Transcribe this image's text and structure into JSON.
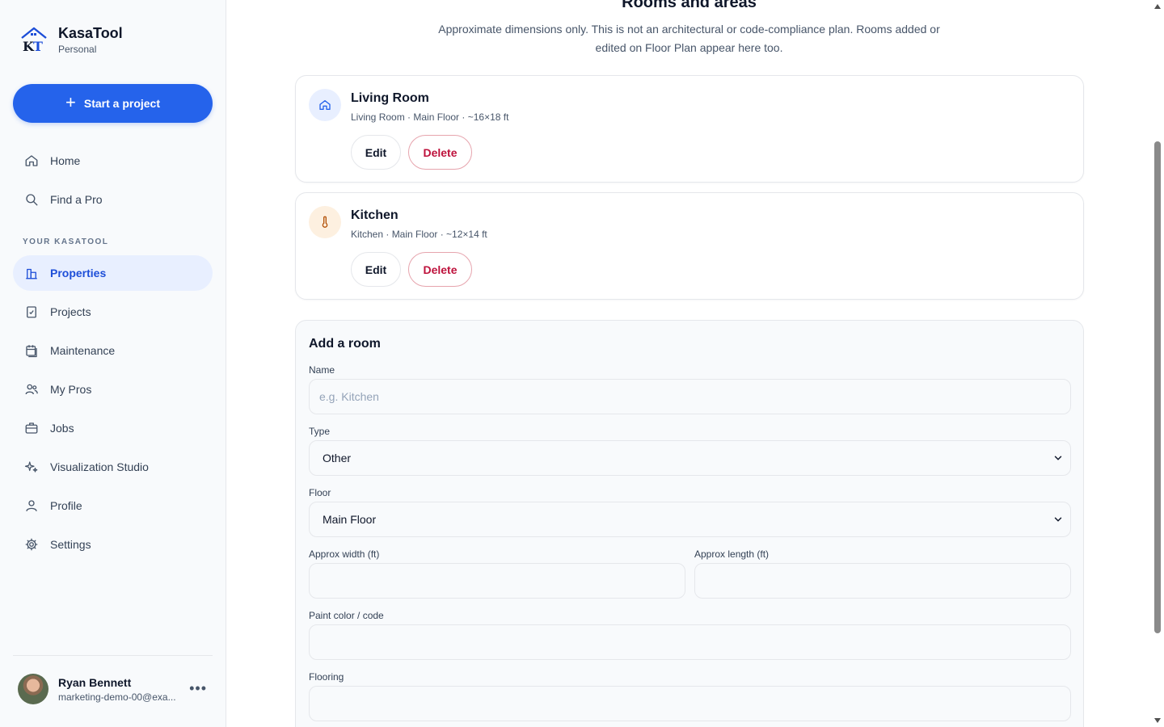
{
  "brand": {
    "name": "KasaTool",
    "plan": "Personal"
  },
  "sidebar": {
    "start_project_label": "Start a project",
    "items_top": [
      {
        "label": "Home",
        "icon": "home-icon"
      },
      {
        "label": "Find a Pro",
        "icon": "search-icon"
      }
    ],
    "section_label": "YOUR KASATOOL",
    "items": [
      {
        "label": "Properties",
        "icon": "building-icon",
        "active": true
      },
      {
        "label": "Projects",
        "icon": "clipboard-icon"
      },
      {
        "label": "Maintenance",
        "icon": "calendar-icon"
      },
      {
        "label": "My Pros",
        "icon": "users-icon"
      },
      {
        "label": "Jobs",
        "icon": "briefcase-icon"
      },
      {
        "label": "Visualization Studio",
        "icon": "sparkles-icon"
      },
      {
        "label": "Profile",
        "icon": "user-icon"
      },
      {
        "label": "Settings",
        "icon": "gear-icon"
      }
    ],
    "user": {
      "name": "Ryan Bennett",
      "email": "marketing-demo-00@exa...",
      "more": "•••"
    }
  },
  "main": {
    "title": "Rooms and areas",
    "subtitle": "Approximate dimensions only. This is not an architectural or code-compliance plan. Rooms added or edited on Floor Plan appear here too.",
    "rooms": [
      {
        "name": "Living Room",
        "meta": "Living Room · Main Floor · ~16×18 ft",
        "icon": "home-icon",
        "edit_label": "Edit",
        "delete_label": "Delete"
      },
      {
        "name": "Kitchen",
        "meta": "Kitchen · Main Floor · ~12×14 ft",
        "icon": "thermometer-icon",
        "edit_label": "Edit",
        "delete_label": "Delete"
      }
    ],
    "add_room": {
      "title": "Add a room",
      "name_label": "Name",
      "name_placeholder": "e.g. Kitchen",
      "name_value": "",
      "type_label": "Type",
      "type_value": "Other",
      "floor_label": "Floor",
      "floor_value": "Main Floor",
      "width_label": "Approx width (ft)",
      "width_value": "",
      "length_label": "Approx length (ft)",
      "length_value": "",
      "paint_label": "Paint color / code",
      "paint_value": "",
      "flooring_label": "Flooring",
      "flooring_value": ""
    }
  },
  "colors": {
    "accent": "#2563eb",
    "danger": "#be123c",
    "active_bg": "#e8efff"
  }
}
